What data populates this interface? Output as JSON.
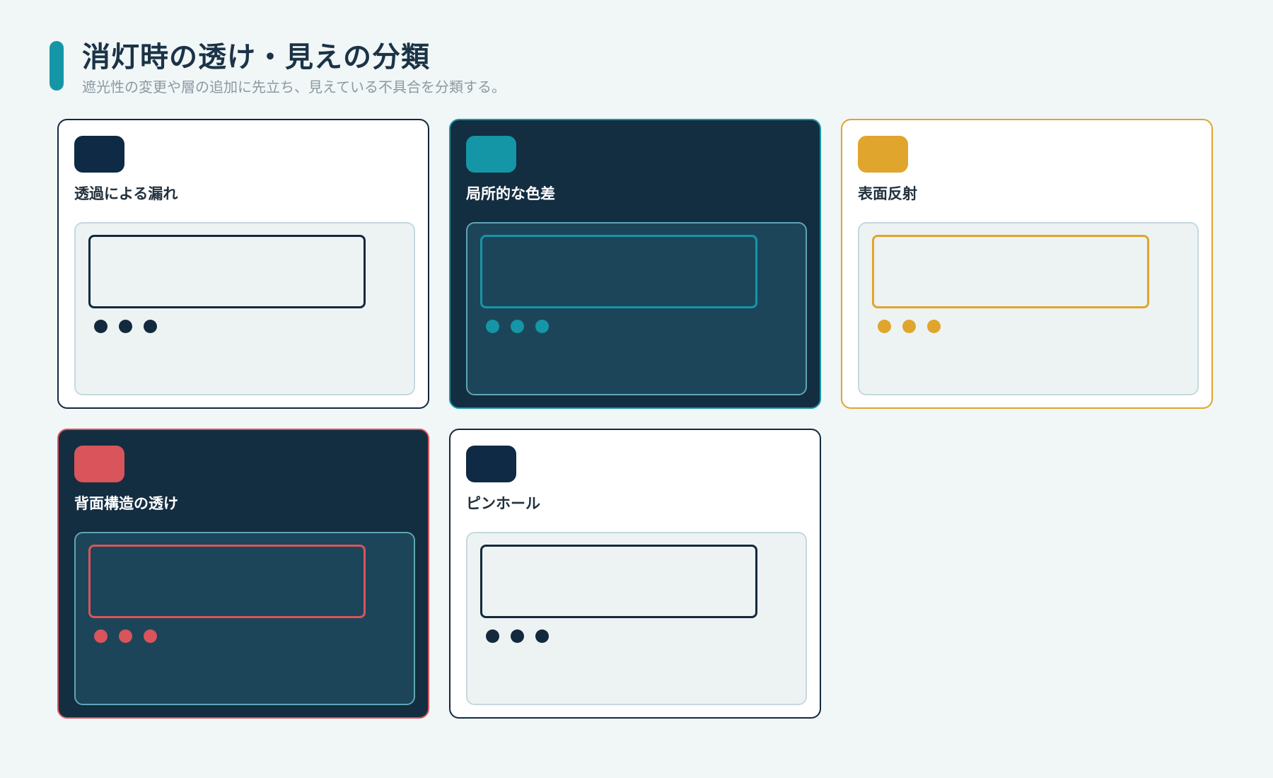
{
  "header": {
    "title": "消灯時の透け・見えの分類",
    "subtitle": "遮光性の変更や層の追加に先立ち、見えている不具合を分類する。",
    "accent_color": "#1596a6"
  },
  "cards": [
    {
      "label": "透過による漏れ",
      "theme": "light",
      "accent_color": "#13293d",
      "badge_color": "#0f2a44",
      "indicator_dots": 3
    },
    {
      "label": "局所的な色差",
      "theme": "dark",
      "accent_color": "#1596a6",
      "badge_color": "#1596a6",
      "indicator_dots": 3
    },
    {
      "label": "表面反射",
      "theme": "light",
      "accent_color": "#e0a52c",
      "badge_color": "#e0a52c",
      "indicator_dots": 3
    },
    {
      "label": "背面構造の透け",
      "theme": "dark",
      "accent_color": "#d9545b",
      "badge_color": "#d9545b",
      "indicator_dots": 3
    },
    {
      "label": "ピンホール",
      "theme": "light",
      "accent_color": "#13293d",
      "badge_color": "#0f2a44",
      "indicator_dots": 3
    }
  ]
}
